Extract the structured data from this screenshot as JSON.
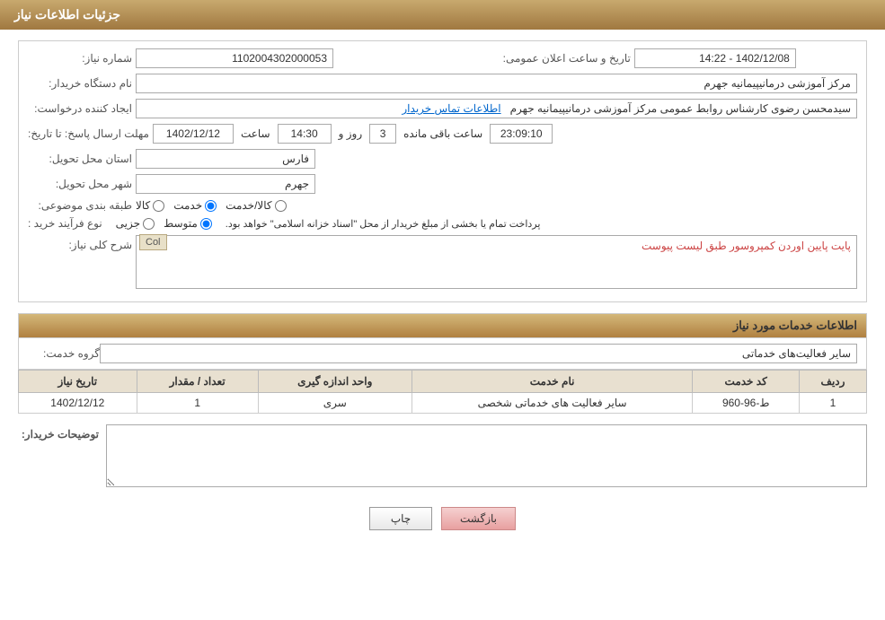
{
  "header": {
    "title": "جزئیات اطلاعات نیاز"
  },
  "need_info": {
    "number_label": "شماره نیاز:",
    "number_value": "1102004302000053",
    "announce_datetime_label": "تاریخ و ساعت اعلان عمومی:",
    "announce_datetime_value": "1402/12/08 - 14:22",
    "buyer_org_label": "نام دستگاه خریدار:",
    "buyer_org_value": "مرکز آموزشی درمانیپیمانیه جهرم",
    "creator_label": "ایجاد کننده درخواست:",
    "creator_value": "سیدمحسن رضوی کارشناس روابط عمومی مرکز آموزشی درمانیپیمانیه جهرم",
    "contact_link": "اطلاعات تماس خریدار",
    "response_deadline_label": "مهلت ارسال پاسخ: تا تاریخ:",
    "response_date_value": "1402/12/12",
    "response_time_label": "ساعت",
    "response_time_value": "14:30",
    "response_days_label": "روز و",
    "response_days_value": "3",
    "response_remaining_label": "ساعت باقی مانده",
    "response_remaining_value": "23:09:10",
    "province_label": "استان محل تحویل:",
    "province_value": "فارس",
    "city_label": "شهر محل تحویل:",
    "city_value": "جهرم",
    "category_label": "طبقه بندی موضوعی:",
    "category_options": [
      "کالا",
      "خدمت",
      "کالا/خدمت"
    ],
    "category_selected": "خدمت",
    "purchase_type_label": "نوع فرآیند خرید :",
    "purchase_options": [
      "جزیی",
      "متوسط"
    ],
    "purchase_note": "پرداخت تمام یا بخشی از مبلغ خریدار از محل \"اسناد خزانه اسلامی\" خواهد بود.",
    "description_label": "شرح کلی نیاز:",
    "description_value": "پایت پایین اوردن کمپروسور  طبق لیست پیوست",
    "col_badge": "Col"
  },
  "services": {
    "section_title": "اطلاعات خدمات مورد نیاز",
    "group_label": "گروه خدمت:",
    "group_value": "سایر فعالیت‌های خدماتی",
    "table": {
      "headers": [
        "ردیف",
        "کد خدمت",
        "نام خدمت",
        "واحد اندازه گیری",
        "تعداد / مقدار",
        "تاریخ نیاز"
      ],
      "rows": [
        {
          "row": "1",
          "code": "ط-96-960",
          "name": "سایر فعالیت های خدماتی شخصی",
          "unit": "سری",
          "quantity": "1",
          "date": "1402/12/12"
        }
      ]
    }
  },
  "buyer_notes": {
    "label": "توضیحات خریدار:",
    "value": ""
  },
  "buttons": {
    "print_label": "چاپ",
    "back_label": "بازگشت"
  }
}
